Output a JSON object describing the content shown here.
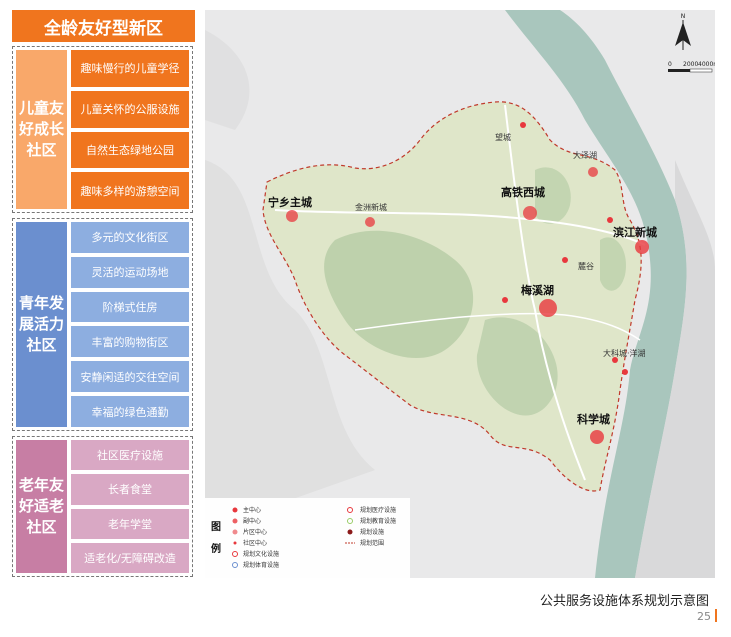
{
  "title": "全龄友好型新区",
  "groups": [
    {
      "label": "儿童友好成长社区",
      "color": "#f9a86a",
      "item_color": "#f0751e",
      "items": [
        "趣味慢行的儿童学径",
        "儿童关怀的公服设施",
        "自然生态绿地公园",
        "趣味多样的游憩空间"
      ]
    },
    {
      "label": "青年发展活力社区",
      "color": "#6b8fcf",
      "item_color": "#8daee0",
      "items": [
        "多元的文化街区",
        "灵活的运动场地",
        "阶梯式住房",
        "丰富的购物街区",
        "安静闲适的交往空间",
        "幸福的绿色通勤"
      ]
    },
    {
      "label": "老年友好适老社区",
      "color": "#c77ea4",
      "item_color": "#d9a8c4",
      "items": [
        "社区医疗设施",
        "长者食堂",
        "老年学堂",
        "适老化/无障碍改造"
      ]
    }
  ],
  "map": {
    "places": [
      {
        "name": "宁乡主城",
        "bold": true
      },
      {
        "name": "金洲新城",
        "bold": false
      },
      {
        "name": "望城",
        "bold": false
      },
      {
        "name": "高铁西城",
        "bold": true
      },
      {
        "name": "大泽湖",
        "bold": false
      },
      {
        "name": "滨江新城",
        "bold": true
      },
      {
        "name": "麓谷",
        "bold": false
      },
      {
        "name": "梅溪湖",
        "bold": true
      },
      {
        "name": "大科城·洋湖",
        "bold": false
      },
      {
        "name": "科学城",
        "bold": true
      }
    ],
    "scale": {
      "ticks": [
        "0",
        "2000",
        "4000m"
      ]
    },
    "legend": {
      "title": "图例",
      "left": [
        "主中心",
        "副中心",
        "片区中心",
        "社区中心",
        "规划文化设施",
        "规划体育设施"
      ],
      "right": [
        "规划医疗设施",
        "规划教育设施",
        "规划设施",
        "规划范围"
      ]
    }
  },
  "caption": "公共服务设施体系规划示意图",
  "page_number": "25",
  "colors": {
    "accent": "#f0751e",
    "center_red": "#e8383d",
    "river": "#a9c6bd",
    "district": "#dfe6c9"
  }
}
